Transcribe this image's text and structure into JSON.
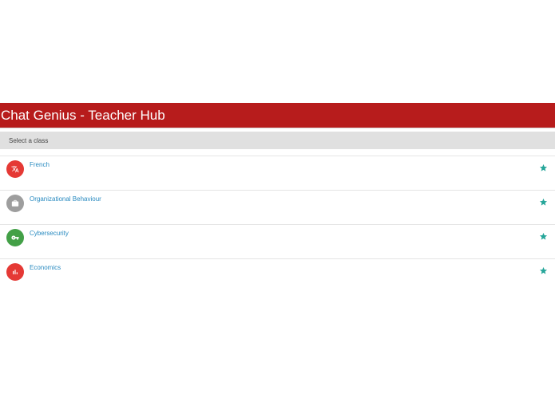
{
  "header": {
    "title": "Chat Genius - Teacher Hub"
  },
  "subheader": {
    "label": "Select a class"
  },
  "classes": [
    {
      "label": "French",
      "icon": "translate-icon",
      "color": "#e53935"
    },
    {
      "label": "Organizational Behaviour",
      "icon": "briefcase-icon",
      "color": "#9e9e9e"
    },
    {
      "label": "Cybersecurity",
      "icon": "key-icon",
      "color": "#43a047"
    },
    {
      "label": "Economics",
      "icon": "bar-chart-icon",
      "color": "#e53935"
    }
  ],
  "colors": {
    "header_bg": "#b71c1c",
    "subheader_bg": "#e0e0e0",
    "link": "#2a8bc0",
    "star": "#26a69a"
  }
}
